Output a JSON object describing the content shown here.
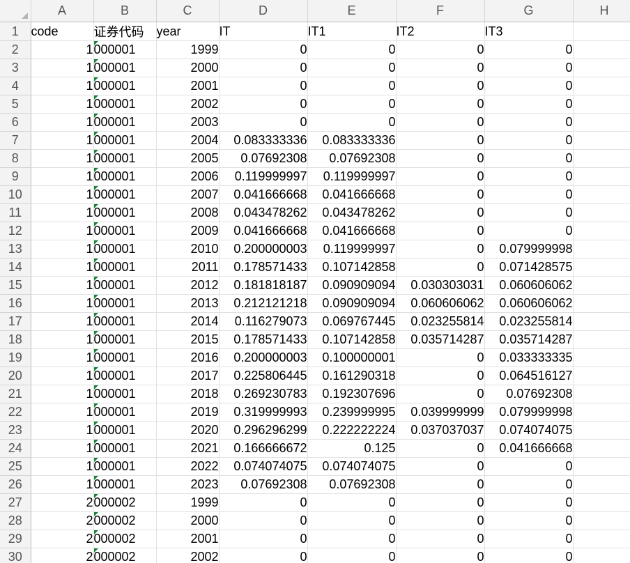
{
  "columns": [
    "A",
    "B",
    "C",
    "D",
    "E",
    "F",
    "G",
    "H"
  ],
  "header_row": {
    "row_number": "1",
    "cells": [
      "code",
      "证券代码",
      "year",
      "IT",
      "IT1",
      "IT2",
      "IT3",
      ""
    ]
  },
  "rows": [
    {
      "n": "2",
      "code": "1",
      "sec": "000001",
      "year": "1999",
      "it": "0",
      "it1": "0",
      "it2": "0",
      "it3": "0"
    },
    {
      "n": "3",
      "code": "1",
      "sec": "000001",
      "year": "2000",
      "it": "0",
      "it1": "0",
      "it2": "0",
      "it3": "0"
    },
    {
      "n": "4",
      "code": "1",
      "sec": "000001",
      "year": "2001",
      "it": "0",
      "it1": "0",
      "it2": "0",
      "it3": "0"
    },
    {
      "n": "5",
      "code": "1",
      "sec": "000001",
      "year": "2002",
      "it": "0",
      "it1": "0",
      "it2": "0",
      "it3": "0"
    },
    {
      "n": "6",
      "code": "1",
      "sec": "000001",
      "year": "2003",
      "it": "0",
      "it1": "0",
      "it2": "0",
      "it3": "0"
    },
    {
      "n": "7",
      "code": "1",
      "sec": "000001",
      "year": "2004",
      "it": "0.083333336",
      "it1": "0.083333336",
      "it2": "0",
      "it3": "0"
    },
    {
      "n": "8",
      "code": "1",
      "sec": "000001",
      "year": "2005",
      "it": "0.07692308",
      "it1": "0.07692308",
      "it2": "0",
      "it3": "0"
    },
    {
      "n": "9",
      "code": "1",
      "sec": "000001",
      "year": "2006",
      "it": "0.119999997",
      "it1": "0.119999997",
      "it2": "0",
      "it3": "0"
    },
    {
      "n": "10",
      "code": "1",
      "sec": "000001",
      "year": "2007",
      "it": "0.041666668",
      "it1": "0.041666668",
      "it2": "0",
      "it3": "0"
    },
    {
      "n": "11",
      "code": "1",
      "sec": "000001",
      "year": "2008",
      "it": "0.043478262",
      "it1": "0.043478262",
      "it2": "0",
      "it3": "0"
    },
    {
      "n": "12",
      "code": "1",
      "sec": "000001",
      "year": "2009",
      "it": "0.041666668",
      "it1": "0.041666668",
      "it2": "0",
      "it3": "0"
    },
    {
      "n": "13",
      "code": "1",
      "sec": "000001",
      "year": "2010",
      "it": "0.200000003",
      "it1": "0.119999997",
      "it2": "0",
      "it3": "0.079999998"
    },
    {
      "n": "14",
      "code": "1",
      "sec": "000001",
      "year": "2011",
      "it": "0.178571433",
      "it1": "0.107142858",
      "it2": "0",
      "it3": "0.071428575"
    },
    {
      "n": "15",
      "code": "1",
      "sec": "000001",
      "year": "2012",
      "it": "0.181818187",
      "it1": "0.090909094",
      "it2": "0.030303031",
      "it3": "0.060606062"
    },
    {
      "n": "16",
      "code": "1",
      "sec": "000001",
      "year": "2013",
      "it": "0.212121218",
      "it1": "0.090909094",
      "it2": "0.060606062",
      "it3": "0.060606062"
    },
    {
      "n": "17",
      "code": "1",
      "sec": "000001",
      "year": "2014",
      "it": "0.116279073",
      "it1": "0.069767445",
      "it2": "0.023255814",
      "it3": "0.023255814"
    },
    {
      "n": "18",
      "code": "1",
      "sec": "000001",
      "year": "2015",
      "it": "0.178571433",
      "it1": "0.107142858",
      "it2": "0.035714287",
      "it3": "0.035714287"
    },
    {
      "n": "19",
      "code": "1",
      "sec": "000001",
      "year": "2016",
      "it": "0.200000003",
      "it1": "0.100000001",
      "it2": "0",
      "it3": "0.033333335"
    },
    {
      "n": "20",
      "code": "1",
      "sec": "000001",
      "year": "2017",
      "it": "0.225806445",
      "it1": "0.161290318",
      "it2": "0",
      "it3": "0.064516127"
    },
    {
      "n": "21",
      "code": "1",
      "sec": "000001",
      "year": "2018",
      "it": "0.269230783",
      "it1": "0.192307696",
      "it2": "0",
      "it3": "0.07692308"
    },
    {
      "n": "22",
      "code": "1",
      "sec": "000001",
      "year": "2019",
      "it": "0.319999993",
      "it1": "0.239999995",
      "it2": "0.039999999",
      "it3": "0.079999998"
    },
    {
      "n": "23",
      "code": "1",
      "sec": "000001",
      "year": "2020",
      "it": "0.296296299",
      "it1": "0.222222224",
      "it2": "0.037037037",
      "it3": "0.074074075"
    },
    {
      "n": "24",
      "code": "1",
      "sec": "000001",
      "year": "2021",
      "it": "0.166666672",
      "it1": "0.125",
      "it2": "0",
      "it3": "0.041666668"
    },
    {
      "n": "25",
      "code": "1",
      "sec": "000001",
      "year": "2022",
      "it": "0.074074075",
      "it1": "0.074074075",
      "it2": "0",
      "it3": "0"
    },
    {
      "n": "26",
      "code": "1",
      "sec": "000001",
      "year": "2023",
      "it": "0.07692308",
      "it1": "0.07692308",
      "it2": "0",
      "it3": "0"
    },
    {
      "n": "27",
      "code": "2",
      "sec": "000002",
      "year": "1999",
      "it": "0",
      "it1": "0",
      "it2": "0",
      "it3": "0"
    },
    {
      "n": "28",
      "code": "2",
      "sec": "000002",
      "year": "2000",
      "it": "0",
      "it1": "0",
      "it2": "0",
      "it3": "0"
    },
    {
      "n": "29",
      "code": "2",
      "sec": "000002",
      "year": "2001",
      "it": "0",
      "it1": "0",
      "it2": "0",
      "it3": "0"
    },
    {
      "n": "30",
      "code": "2",
      "sec": "000002",
      "year": "2002",
      "it": "0",
      "it1": "0",
      "it2": "0",
      "it3": "0"
    }
  ]
}
